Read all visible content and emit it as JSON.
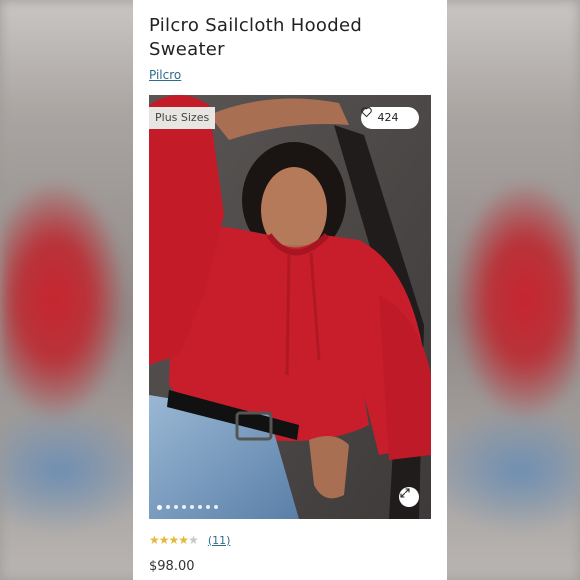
{
  "product": {
    "title": "Pilcro Sailcloth Hooded Sweater",
    "brand": "Pilcro",
    "price": "$98.00"
  },
  "image": {
    "tag": "Plus Sizes",
    "likes": "424",
    "carousel_count": 8,
    "carousel_active": 1
  },
  "rating": {
    "stars": 4,
    "max": 5,
    "reviews": "(11)"
  },
  "icons": {
    "heart": "heart-icon",
    "expand": "expand-icon",
    "star": "star-icon"
  },
  "colors": {
    "sweater": "#c81e2c",
    "link": "#2f6c8f",
    "star": "#e2b93b"
  }
}
